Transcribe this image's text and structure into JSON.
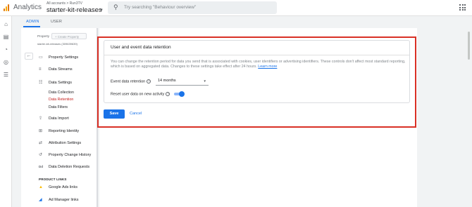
{
  "header": {
    "app_name": "Analytics",
    "breadcrumb": "All accounts > Run3TV",
    "property_name": "starter-kit-releases",
    "search_placeholder": "Try searching \"Behaviour overview\""
  },
  "tabs": [
    {
      "label": "ADMIN",
      "active": true
    },
    {
      "label": "USER",
      "active": false
    }
  ],
  "settings_panel": {
    "property_label": "Property",
    "create_property_label": "+ Create Property",
    "property_subtitle": "starter-kit-releases (309639639)",
    "nav": [
      {
        "label": "Property Settings",
        "icon": "property-settings-icon"
      },
      {
        "label": "Data Streams",
        "icon": "data-streams-icon"
      },
      {
        "label": "Data Settings",
        "icon": "data-settings-icon"
      },
      {
        "label": "Data Import",
        "icon": "upload-icon"
      },
      {
        "label": "Reporting Identity",
        "icon": "reporting-identity-icon"
      },
      {
        "label": "Attribution Settings",
        "icon": "attribution-icon"
      },
      {
        "label": "Property Change History",
        "icon": "history-icon"
      },
      {
        "label": "Data Deletion Requests",
        "icon": "dd-icon"
      }
    ],
    "data_settings_sub": [
      {
        "label": "Data Collection",
        "active": false
      },
      {
        "label": "Data Retention",
        "active": true
      },
      {
        "label": "Data Filters",
        "active": false
      }
    ],
    "product_links_title": "PRODUCT LINKS",
    "product_links": [
      {
        "label": "Google Ads links",
        "icon": "google-ads-icon"
      },
      {
        "label": "Ad Manager links",
        "icon": "ad-manager-icon"
      }
    ]
  },
  "retention_card": {
    "title": "User and event data retention",
    "description": "You can change the retention period for data you send that is associated with cookies, user identifiers or advertising identifiers. These controls don't affect most standard reporting, which is based on aggregated data. Changes to these settings take effect after 24 hours.",
    "learn_more": "Learn more",
    "event_retention_label": "Event data retention",
    "event_retention_value": "14 months",
    "reset_label": "Reset user data on new activity",
    "reset_enabled": true
  },
  "actions": {
    "save_label": "Save",
    "cancel_label": "Cancel"
  },
  "colors": {
    "accent": "#1a73e8",
    "highlight_border": "#d93025",
    "active_sub_item": "#c5221f"
  }
}
